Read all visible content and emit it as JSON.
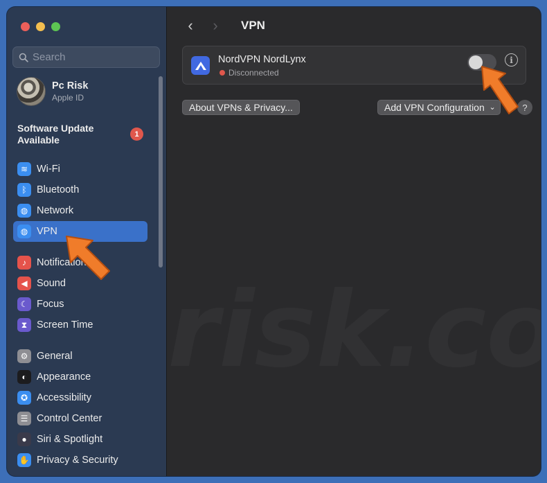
{
  "window": {
    "traffic_lights": [
      "#ec5f5a",
      "#f3be4f",
      "#5dc553"
    ]
  },
  "sidebar": {
    "search_placeholder": "Search",
    "profile": {
      "name": "Pc Risk",
      "subtitle": "Apple ID"
    },
    "software_update": {
      "label": "Software Update Available",
      "badge": "1"
    },
    "groups": [
      [
        {
          "label": "Wi-Fi",
          "icon": "wifi-icon",
          "color": "#3b8ef0"
        },
        {
          "label": "Bluetooth",
          "icon": "bluetooth-icon",
          "color": "#3b8ef0"
        },
        {
          "label": "Network",
          "icon": "globe-icon",
          "color": "#3b8ef0"
        },
        {
          "label": "VPN",
          "icon": "vpn-globe-icon",
          "color": "#3b8ef0",
          "active": true
        }
      ],
      [
        {
          "label": "Notifications",
          "icon": "bell-icon",
          "color": "#e5534b"
        },
        {
          "label": "Sound",
          "icon": "speaker-icon",
          "color": "#e5534b"
        },
        {
          "label": "Focus",
          "icon": "moon-icon",
          "color": "#6a5acd"
        },
        {
          "label": "Screen Time",
          "icon": "hourglass-icon",
          "color": "#6a5acd"
        }
      ],
      [
        {
          "label": "General",
          "icon": "gear-icon",
          "color": "#8e8e93"
        },
        {
          "label": "Appearance",
          "icon": "appearance-icon",
          "color": "#1c1c1e"
        },
        {
          "label": "Accessibility",
          "icon": "accessibility-icon",
          "color": "#3b8ef0"
        },
        {
          "label": "Control Center",
          "icon": "control-center-icon",
          "color": "#8e8e93"
        },
        {
          "label": "Siri & Spotlight",
          "icon": "siri-icon",
          "color": "#3a3a4a"
        },
        {
          "label": "Privacy & Security",
          "icon": "hand-icon",
          "color": "#3b8ef0"
        }
      ]
    ]
  },
  "content": {
    "title": "VPN",
    "vpn": {
      "name": "NordVPN NordLynx",
      "status": "Disconnected",
      "enabled": false
    },
    "about_button": "About VPNs & Privacy...",
    "add_button": "Add VPN Configuration",
    "help_label": "?"
  },
  "watermark": "risk.com"
}
